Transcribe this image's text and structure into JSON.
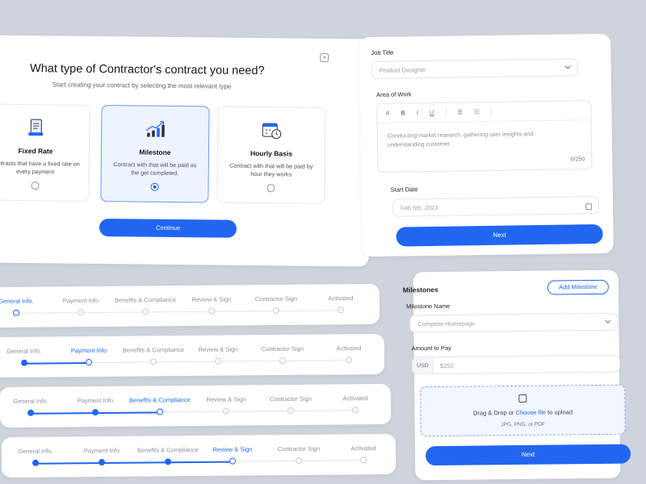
{
  "modal": {
    "title": "What type of Contractor's contract you need?",
    "subtitle": "Start creating your contract by selecting the most relevant type",
    "close_icon": "×",
    "options": [
      {
        "title": "Fixed Rate",
        "desc": "Contracts that have a fixed rate on every payment",
        "icon": "document-pen-icon",
        "selected": false
      },
      {
        "title": "Milestone",
        "desc": "Contract with that will be paid as the get completed.",
        "icon": "growth-chart-icon",
        "selected": true
      },
      {
        "title": "Hourly Basis",
        "desc": "Contract with that will be paid by hour they works",
        "icon": "calendar-clock-icon",
        "selected": false
      }
    ],
    "continue_label": "Continue"
  },
  "job": {
    "job_title_label": "Job Title",
    "job_title_value": "Product Designer",
    "area_label": "Area of Work",
    "toolbar": [
      "A",
      "B",
      "I",
      "U"
    ],
    "area_value": "Conducting market research, gathering user insights and understanding customer.",
    "char_count": "0/250",
    "start_date_label": "Start Date",
    "start_date_value": "Feb 5th, 2023",
    "next_label": "Next"
  },
  "stepper": {
    "steps": [
      "General Info.",
      "Payment Info",
      "Benefits & Compliance",
      "Review & Sign",
      "Contractor Sign",
      "Activated"
    ],
    "instances": [
      {
        "active": 0
      },
      {
        "active": 1
      },
      {
        "active": 2
      },
      {
        "active": 3
      }
    ]
  },
  "milestones": {
    "title": "Milestones",
    "add_label": "Add Milestone",
    "name_label": "Milestone Name",
    "name_value": "Complete Homepage",
    "amount_label": "Amount to Pay",
    "currency": "USD",
    "amount_placeholder": "$250",
    "drop_text_pre": "Drag & Drop or ",
    "drop_link": "Choose file",
    "drop_text_post": " to upload",
    "drop_formats": "JPG, PNG, or PDF",
    "next_label": "Next"
  },
  "colors": {
    "accent": "#2166f0",
    "background": "#cfd3db"
  }
}
